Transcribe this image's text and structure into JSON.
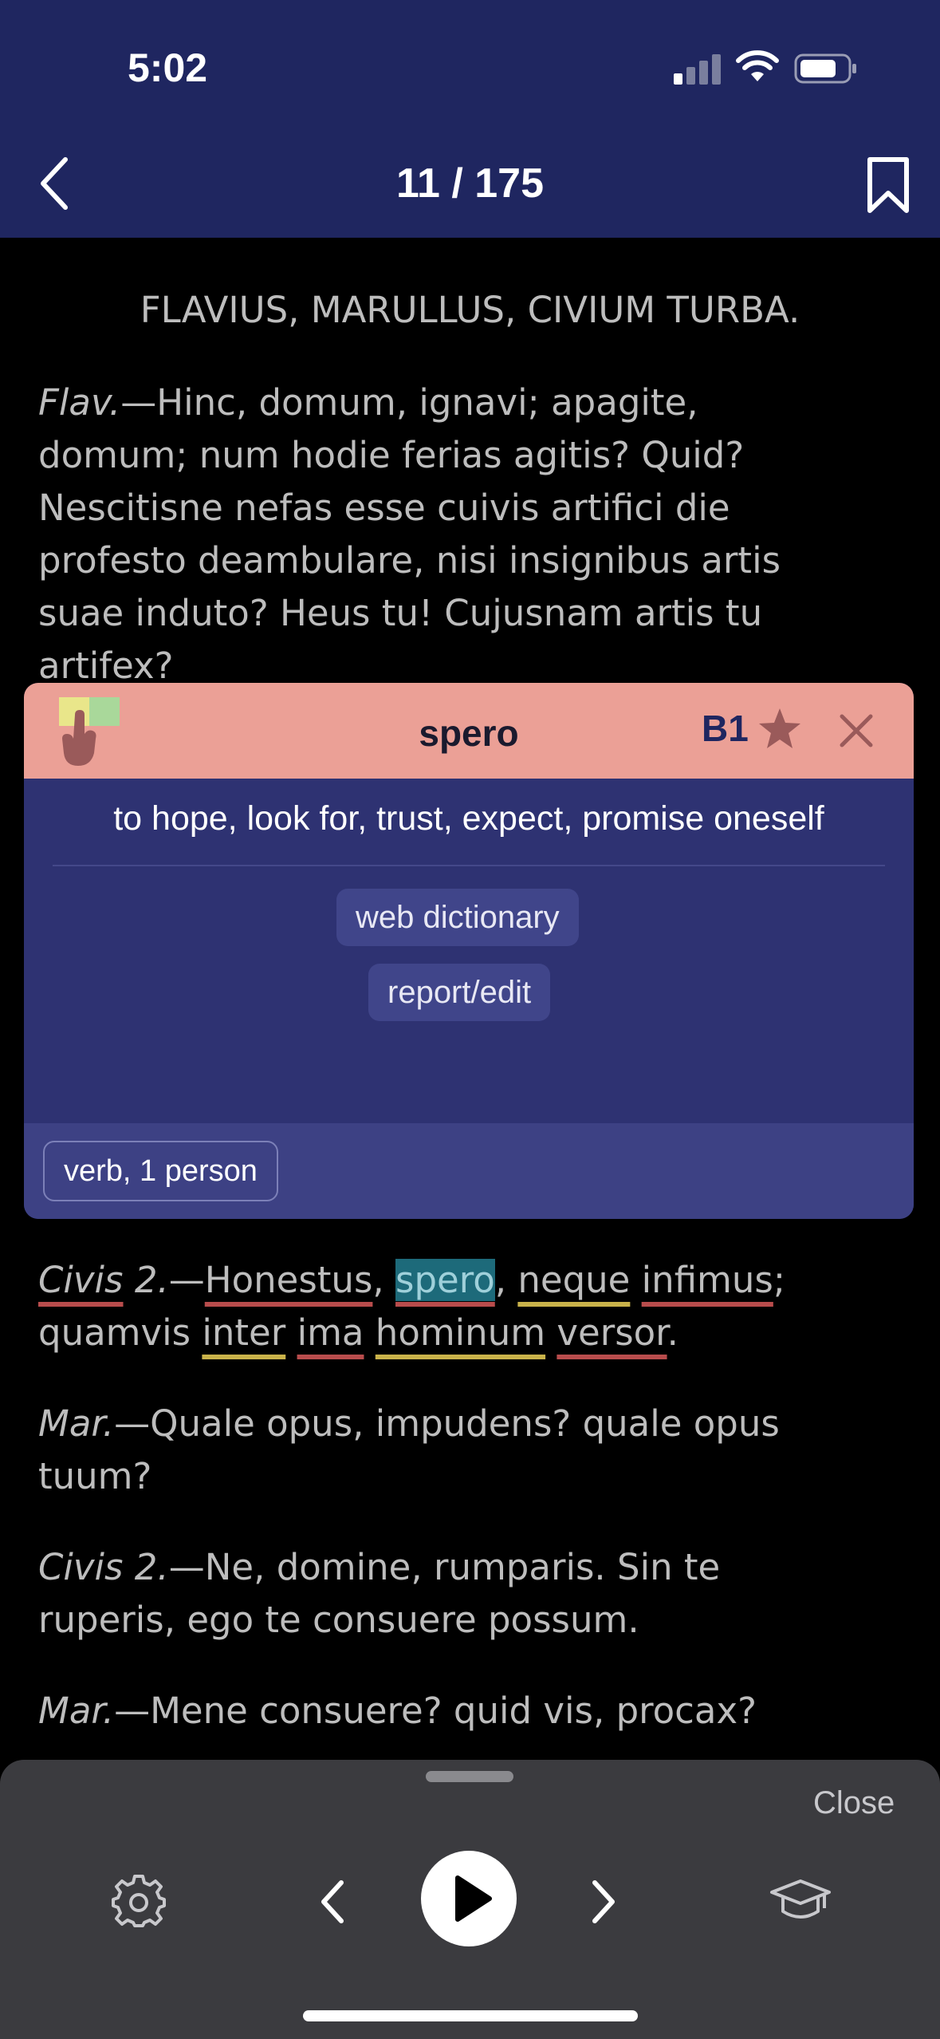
{
  "status_bar": {
    "time": "5:02"
  },
  "header": {
    "page_counter": "11 / 175"
  },
  "reader": {
    "heading": "FLAVIUS, MARULLUS, CIVIUM TURBA.",
    "para1": {
      "speaker": "Flav.",
      "line1": "—Hinc, domum, ignavi; apagite,",
      "line2": "domum; num hodie ferias agitis? Quid?",
      "line3": "Nescitisne nefas esse cuivis artifici die",
      "line4": "profesto deambulare, nisi insignibus artis",
      "line5": "suae induto? Heus tu! Cujusnam artis tu",
      "line6": "artifex?"
    },
    "para2": {
      "speaker": "Civis",
      "num": "2.",
      "dash": "—",
      "w1": "Honestus",
      "c1": ", ",
      "w2": "spero",
      "c2": ", ",
      "w3": "neque",
      "w4": "infimus",
      "c3": ";",
      "w5": "quamvis",
      "w6": "inter",
      "w7": "ima",
      "w8": "hominum",
      "w9": "versor",
      "c4": "."
    },
    "para3": {
      "speaker": "Mar.",
      "line1": "—Quale opus, impudens? quale opus",
      "line2": "tuum?"
    },
    "para4": {
      "speaker": "Civis 2.",
      "line1": "—Ne, domine, rumparis. Sin te",
      "line2": "ruperis, ego te consuere possum."
    },
    "para5": {
      "speaker": "Mar.",
      "line1": "—Mene consuere? quid vis, procax?"
    }
  },
  "popup": {
    "word": "spero",
    "level": "B1",
    "definition": "to hope, look for, trust, expect, promise oneself",
    "web_dictionary_label": "web dictionary",
    "report_edit_label": "report/edit",
    "pos_tag": "verb, 1 person",
    "colors": {
      "header": "#eba096",
      "body": "#2e3272"
    }
  },
  "bottom_bar": {
    "close_label": "Close"
  },
  "colors": {
    "nav_bg": "#1f2660",
    "underline_red": "#b84c4c",
    "underline_yellow": "#c9b24a",
    "selection": "#1d6a7a"
  }
}
